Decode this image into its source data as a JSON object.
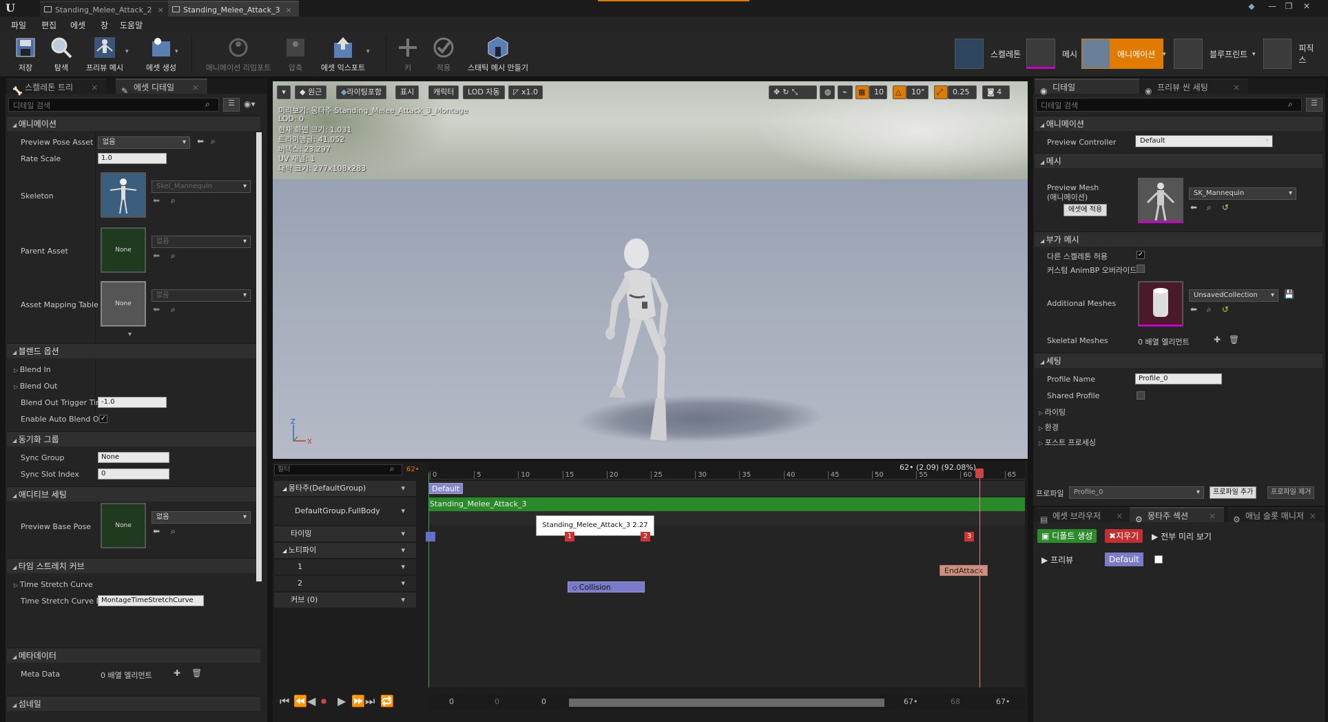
{
  "titlebar": {
    "tabs": [
      "Standing_Melee_Attack_2",
      "Standing_Melee_Attack_3"
    ]
  },
  "menu": [
    "파일",
    "편집",
    "에셋",
    "창",
    "도움말"
  ],
  "toolbar": {
    "buttons": [
      {
        "label": "저장",
        "icon": "save-icon"
      },
      {
        "label": "탐색",
        "icon": "browse-icon"
      },
      {
        "label": "프리뷰 메시",
        "icon": "preview-mesh-icon"
      },
      {
        "label": "에셋 생성",
        "icon": "create-asset-icon"
      },
      {
        "label": "애니메이션 리임포트",
        "icon": "reimport-icon"
      },
      {
        "label": "압축",
        "icon": "compress-icon"
      },
      {
        "label": "에셋 익스포트",
        "icon": "export-icon"
      },
      {
        "label": "키",
        "icon": "key-plus-icon"
      },
      {
        "label": "적용",
        "icon": "apply-check-icon"
      },
      {
        "label": "스태틱 메시 만들기",
        "icon": "static-mesh-icon"
      }
    ],
    "modes": [
      "스켈레톤",
      "메시",
      "애니메이션",
      "블루프린트",
      "피직스"
    ]
  },
  "left": {
    "tabs": [
      "스켈레톤 트리",
      "에셋 디테일"
    ],
    "search_placeholder": "디테일 검색",
    "sections": {
      "animation": "애니메이션",
      "blend": "블렌드 옵션",
      "sync": "동기화 그룹",
      "additive": "애디티브 세팅",
      "timestretch": "타임 스트레치 커브",
      "metadata": "메타데이터",
      "thumbnail": "섬네일"
    },
    "props": {
      "preview_pose_asset": "Preview Pose Asset",
      "preview_pose_value": "없음",
      "rate_scale": "Rate Scale",
      "rate_scale_value": "1.0",
      "skeleton": "Skeleton",
      "skeleton_value": "Skel_Mannequin",
      "parent_asset": "Parent Asset",
      "parent_value": "없음",
      "parent_thumb": "None",
      "asset_mapping": "Asset Mapping Table",
      "asset_mapping_value": "없음",
      "asset_mapping_thumb": "None",
      "blend_in": "Blend In",
      "blend_out": "Blend Out",
      "blend_out_trigger": "Blend Out Trigger Tim",
      "blend_out_trigger_value": "-1.0",
      "enable_auto_blend": "Enable Auto Blend Ou",
      "sync_group": "Sync Group",
      "sync_group_value": "None",
      "sync_slot_index": "Sync Slot Index",
      "sync_slot_value": "0",
      "preview_base_pose": "Preview Base Pose",
      "preview_base_thumb": "None",
      "preview_base_value": "없음",
      "time_stretch_curve": "Time Stretch Curve",
      "time_stretch_curve_n": "Time Stretch Curve N",
      "time_stretch_value": "MontageTimeStretchCurve",
      "meta_data": "Meta Data",
      "meta_data_value": "0 배열 엘리먼트"
    }
  },
  "viewport": {
    "toolbar": {
      "perspective": "원근",
      "lighting": "라이팅포함",
      "show": "표시",
      "character": "캐릭터",
      "lod": "LOD 자동",
      "speed": "x1.0",
      "grid": "10",
      "angle": "10°",
      "scale": "0.25",
      "camera_speed": "4"
    },
    "info": [
      "미리보기: 몽타주 Standing_Melee_Attack_3_Montage",
      "LOD: 0",
      "현재 화면 크기: 1.031",
      "트라이앵글: 41,052",
      "버텍스: 23,297",
      "UV 채널: 1",
      "대략 크기: 277x108x283"
    ]
  },
  "montage": {
    "filter_placeholder": "필터",
    "frame_badge": "62•",
    "status": "62• (2.09) (92.08%)",
    "ticks": [
      "0",
      "5",
      "10",
      "15",
      "20",
      "25",
      "30",
      "35",
      "40",
      "45",
      "50",
      "55",
      "60",
      "65"
    ],
    "tracks": {
      "montage_group": "몽타주(DefaultGroup)",
      "slot": "DefaultGroup.FullBody",
      "timing": "타이밍",
      "notify": "노티파이",
      "notify1": "1",
      "notify2": "2",
      "curve": "커브  (0)"
    },
    "section_label": "Default",
    "clip_label": "Standing_Melee_Attack_3",
    "tooltip": "Standing_Melee_Attack_3 2.27",
    "timing_markers": [
      "1",
      "2",
      "3"
    ],
    "notify_end": "EndAttack",
    "notify_collision": "Collision",
    "bottom_values": [
      "0",
      "0",
      "0",
      "67•",
      "68",
      "67•"
    ]
  },
  "right": {
    "tabs": [
      "디테일",
      "프리뷰 씬 세팅"
    ],
    "search_placeholder": "디테일 검색",
    "sections": {
      "animation": "애니메이션",
      "mesh": "메시",
      "additional": "부가 메시",
      "settings": "세팅"
    },
    "props": {
      "preview_controller": "Preview Controller",
      "preview_controller_value": "Default",
      "preview_mesh": "Preview Mesh",
      "preview_mesh_sub": "(애니메이션)",
      "apply_to_asset": "에셋에 적용",
      "preview_mesh_value": "SK_Mannequin",
      "allow_other_skel": "다른 스켈레톤 허용",
      "custom_animbp": "커스텀 AnimBP 오버라이드",
      "additional_meshes": "Additional Meshes",
      "additional_value": "UnsavedCollection",
      "skeletal_meshes": "Skeletal Meshes",
      "skeletal_value": "0 배열 엘리먼트",
      "profile_name": "Profile Name",
      "profile_name_value": "Profile_0",
      "shared_profile": "Shared Profile",
      "lighting": "라이팅",
      "environment": "환경",
      "post_process": "포스트 프로세싱",
      "profile_label": "프로파일",
      "profile_value": "Profile_0",
      "add_profile": "프로파일 추가",
      "remove_profile": "프로파일 제거"
    },
    "bottom_tabs": [
      "에셋 브라우저",
      "몽타주 섹션",
      "애님 슬롯 매니저"
    ],
    "montage_section": {
      "create_default": "디폴트 생성",
      "clear": "지우기",
      "preview_all": "전부 미리 보기",
      "preview": "프리뷰",
      "default_chip": "Default"
    }
  },
  "colors": {
    "accent_orange": "#e07b00",
    "green_button": "#2d8a2d",
    "red_button": "#c03030",
    "clip_green": "#2a8a2a",
    "section_purple": "#7b7bc8"
  }
}
